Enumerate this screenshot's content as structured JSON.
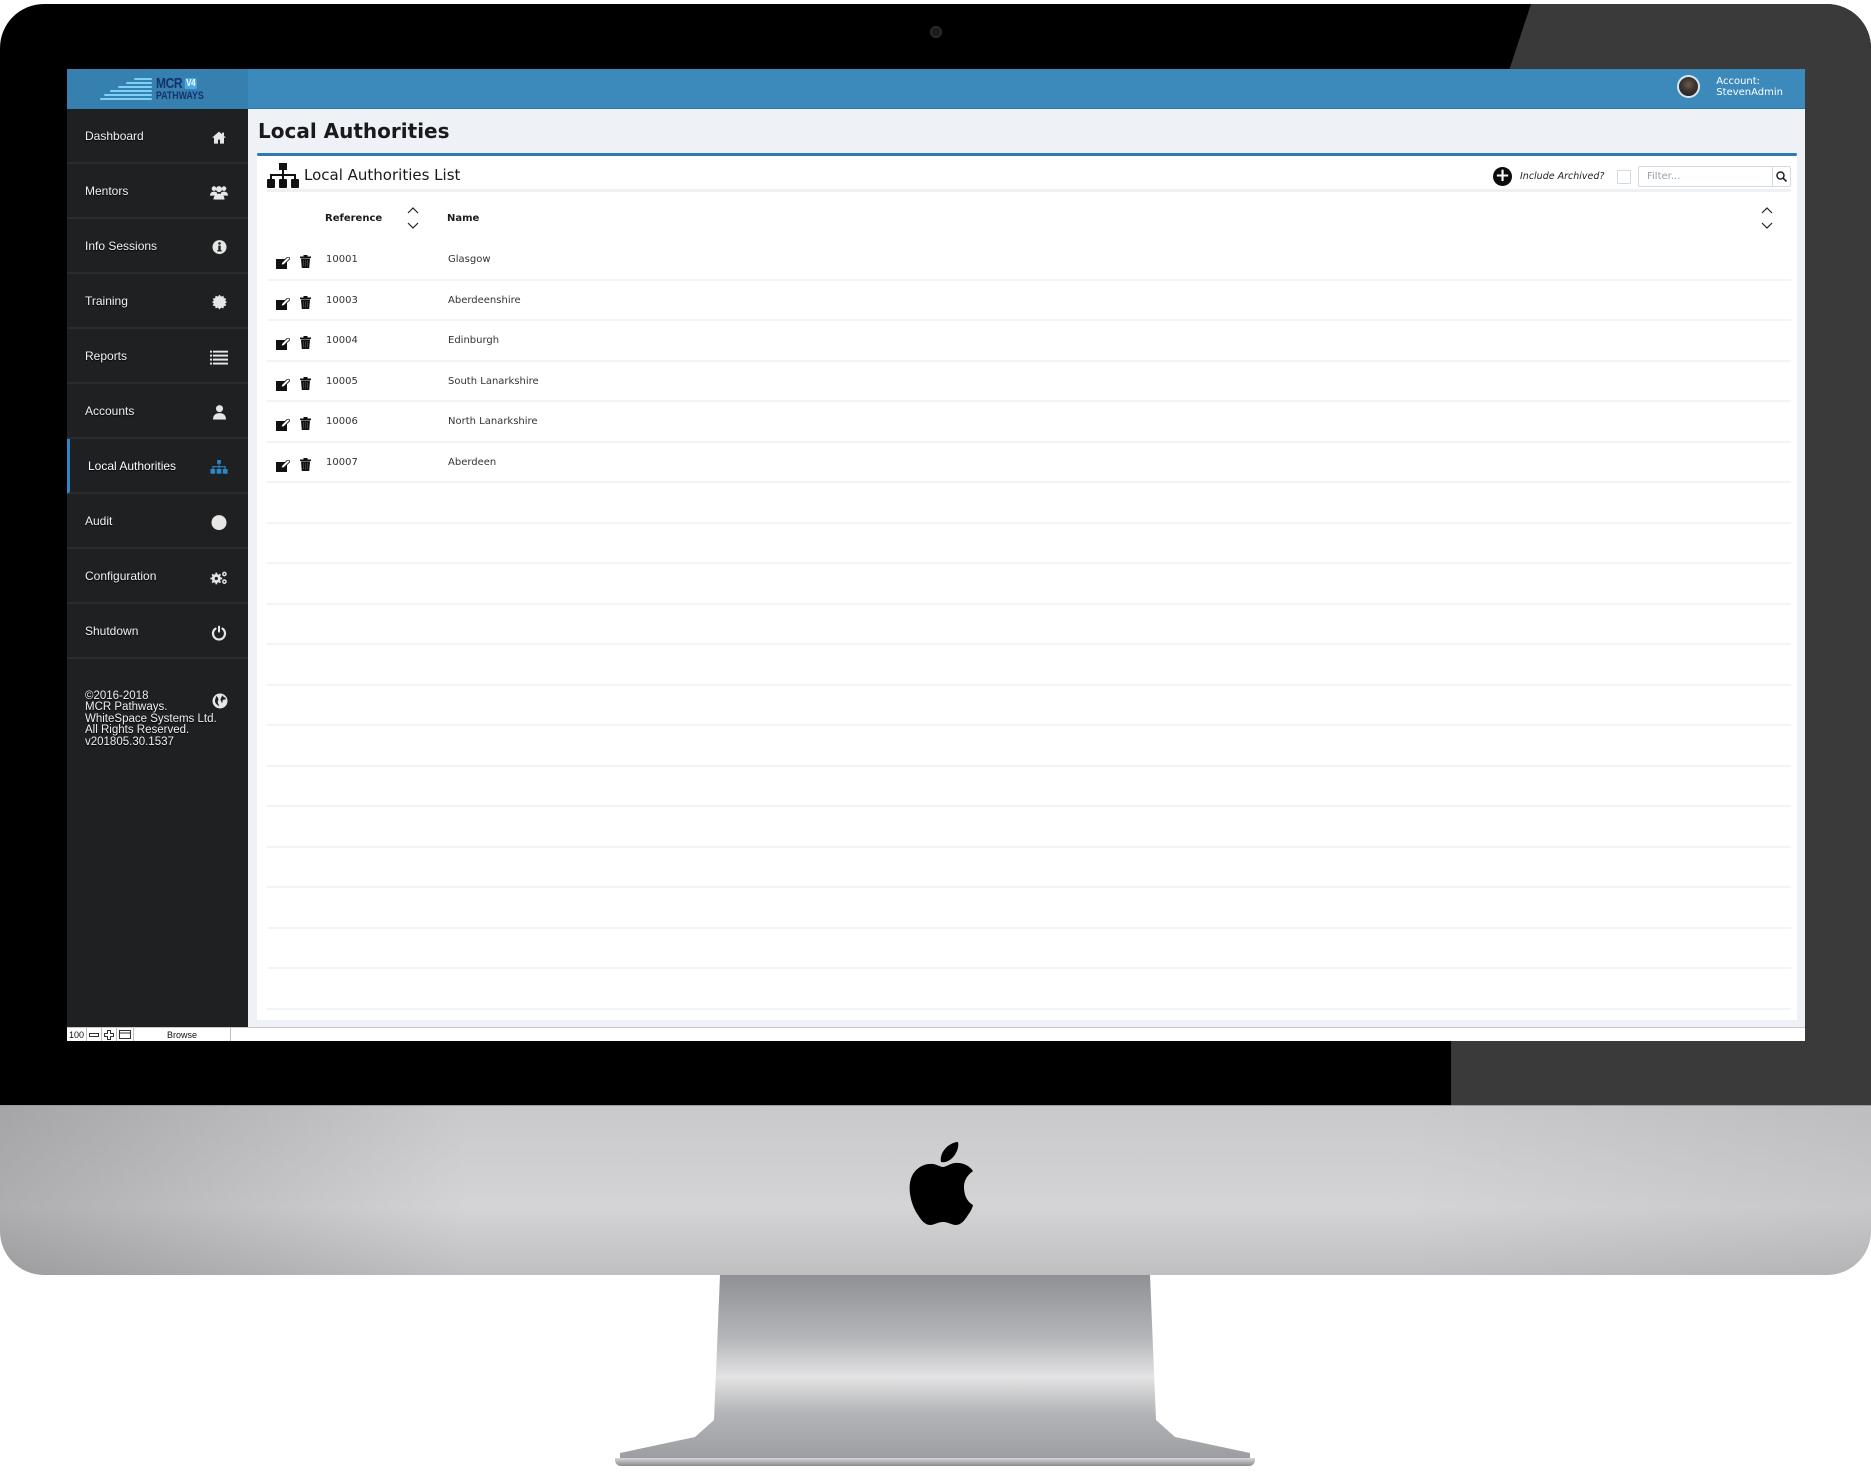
{
  "app": {
    "logo": {
      "line1": "MCR",
      "badge": "V4",
      "line2": "PATHWAYS"
    },
    "account": {
      "label": "Account:",
      "username": "StevenAdmin"
    }
  },
  "sidebar": {
    "items": [
      {
        "label": "Dashboard",
        "icon": "home-icon"
      },
      {
        "label": "Mentors",
        "icon": "users-icon"
      },
      {
        "label": "Info Sessions",
        "icon": "info-icon"
      },
      {
        "label": "Training",
        "icon": "certificate-icon"
      },
      {
        "label": "Reports",
        "icon": "list-icon"
      },
      {
        "label": "Accounts",
        "icon": "user-icon"
      },
      {
        "label": "Local Authorities",
        "icon": "sitemap-icon",
        "active": true
      },
      {
        "label": "Audit",
        "icon": "circle-icon"
      },
      {
        "label": "Configuration",
        "icon": "gears-icon"
      },
      {
        "label": "Shutdown",
        "icon": "power-icon"
      }
    ],
    "copyright": "©2016-2018\nMCR Pathways.\nWhiteSpace Systems Ltd.\nAll Rights Reserved.\nv201805.30.1537",
    "active_color": "#2c86c8"
  },
  "main": {
    "page_title": "Local Authorities",
    "panel_title": "Local Authorities List",
    "include_archived_label": "Include Archived?",
    "include_archived_checked": false,
    "filter": {
      "value": "",
      "placeholder": "Filter..."
    },
    "columns": [
      "Reference",
      "Name"
    ],
    "rows": [
      {
        "reference": "10001",
        "name": "Glasgow"
      },
      {
        "reference": "10003",
        "name": "Aberdeenshire"
      },
      {
        "reference": "10004",
        "name": "Edinburgh"
      },
      {
        "reference": "10005",
        "name": "South Lanarkshire"
      },
      {
        "reference": "10006",
        "name": "North Lanarkshire"
      },
      {
        "reference": "10007",
        "name": "Aberdeen"
      }
    ],
    "empty_rows": 14
  },
  "statusbar": {
    "zoom": "100",
    "mode": "Browse"
  },
  "colors": {
    "header": "#3b8abb",
    "sidebar": "#1f2022",
    "accent": "#2b7bb0"
  }
}
